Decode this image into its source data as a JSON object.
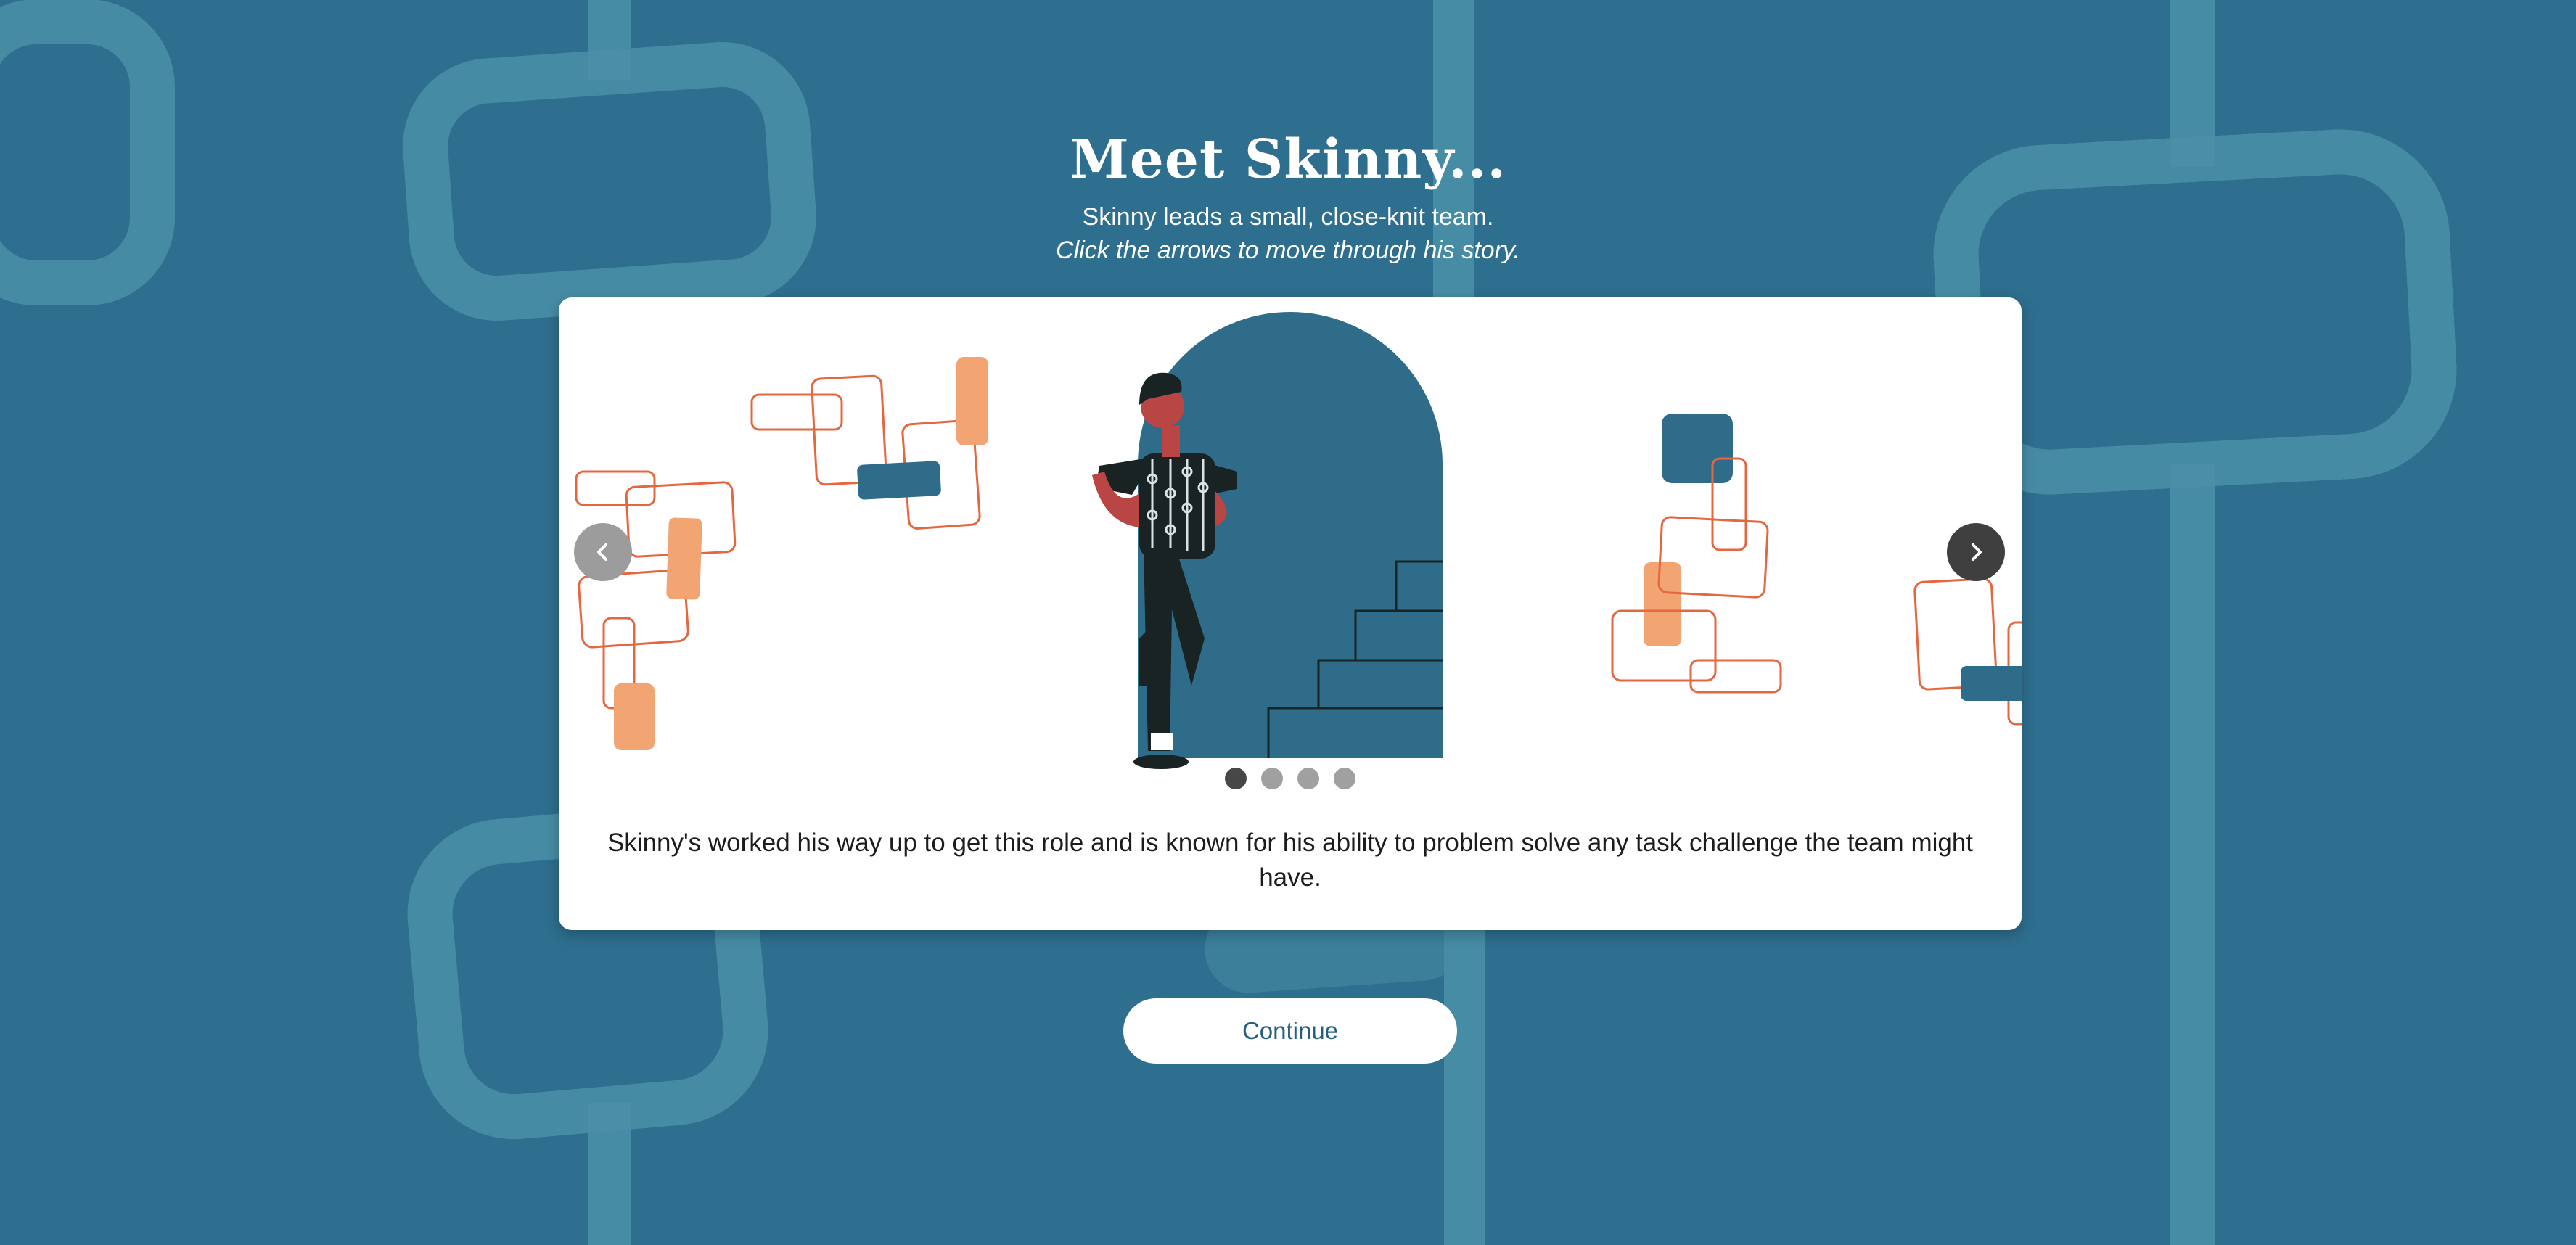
{
  "header": {
    "title": "Meet Skinny...",
    "subtitle": "Skinny leads a small, close-knit team.",
    "instruction": "Click the arrows to move through his story."
  },
  "carousel": {
    "slide_index": 1,
    "slide_count": 4,
    "caption": "Skinny's worked his way up to get this role and is known for his ability to problem solve any task challenge the team might have.",
    "prev_icon": "chevron-left-icon",
    "next_icon": "chevron-right-icon"
  },
  "continue_button": {
    "label": "Continue"
  },
  "colors": {
    "background": "#2e6e8e",
    "pattern": "#4a8fa7",
    "teal": "#2e6c8a",
    "orange_outline": "#e5673f",
    "peach": "#f2a572",
    "skin": "#b94644",
    "ink": "#1a2323",
    "button_text": "#25617f"
  }
}
